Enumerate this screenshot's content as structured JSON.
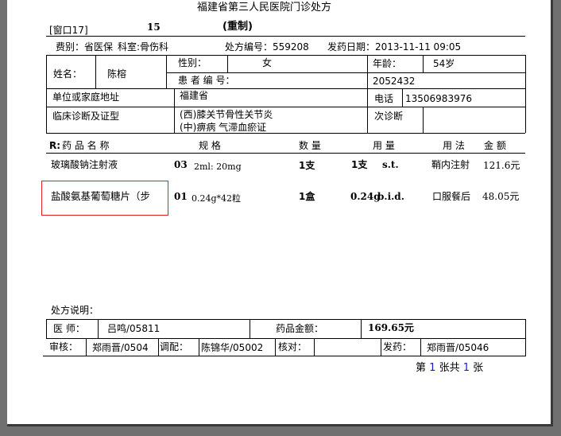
{
  "header": {
    "title": "福建省第三人民医院门诊处方",
    "window": "[窗口17]",
    "queue_no": "15",
    "stamp": "(重制)"
  },
  "info": {
    "fee_type": "费别：省医保",
    "department": "科室:骨伤科",
    "rx_no": "处方编号：559208",
    "dispense_date": "发药日期：2013-11-11 09:05"
  },
  "patient": {
    "name_label": "姓名：",
    "name": "陈榕",
    "gender_label": "性别：",
    "gender": "女",
    "age_label": "年龄：",
    "age": "54岁",
    "id_label": "患 者 编 号：",
    "id": "2052432",
    "address_label": "单位或家庭地址",
    "address": "福建省",
    "phone_label": "电话",
    "phone": "13506983976",
    "diagnosis_label": "临床诊断及证型",
    "diagnosis_western": "(西)膝关节骨性关节炎",
    "diagnosis_tcm": "(中)痹病 气滞血瘀证",
    "visit_label": "次诊断"
  },
  "rx_table": {
    "headers": {
      "rx": "R:",
      "drug": "药 品 名 称",
      "spec": "规  格",
      "qty": "数 量",
      "dose": "用 量",
      "usage": "用 法",
      "amount": "金 额"
    },
    "rows": [
      {
        "name": "玻璃酸钠注射液",
        "group": "03",
        "spec": "2ml: 20mg",
        "qty": "1支",
        "dose": "1支",
        "freq": "s.t.",
        "usage": "鞘内注射",
        "amount": "121.6元"
      },
      {
        "name": "盐酸氨基葡萄糖片（步",
        "group": "01",
        "spec": "0.24g*42粒",
        "qty": "1盒",
        "dose": "0.24g",
        "freq": "b.i.d.",
        "usage": "口服餐后",
        "amount": "48.05元"
      }
    ]
  },
  "footer": {
    "notes_label": "处方说明：",
    "doctor_label": "医  师：",
    "doctor": "吕鸣/05811",
    "total_label": "药品金额：",
    "total": "169.65元",
    "review_label": "审核：",
    "reviewer": "郑雨晋/0504",
    "prepare_label": "调配：",
    "preparer": "陈锦华/05002",
    "check_label": "核对：",
    "dispense_label": "发药：",
    "dispenser": "郑雨晋/05046",
    "page_prefix": "第",
    "page_current": "1",
    "page_mid": "张共",
    "page_total": "1",
    "page_suffix": "张"
  }
}
